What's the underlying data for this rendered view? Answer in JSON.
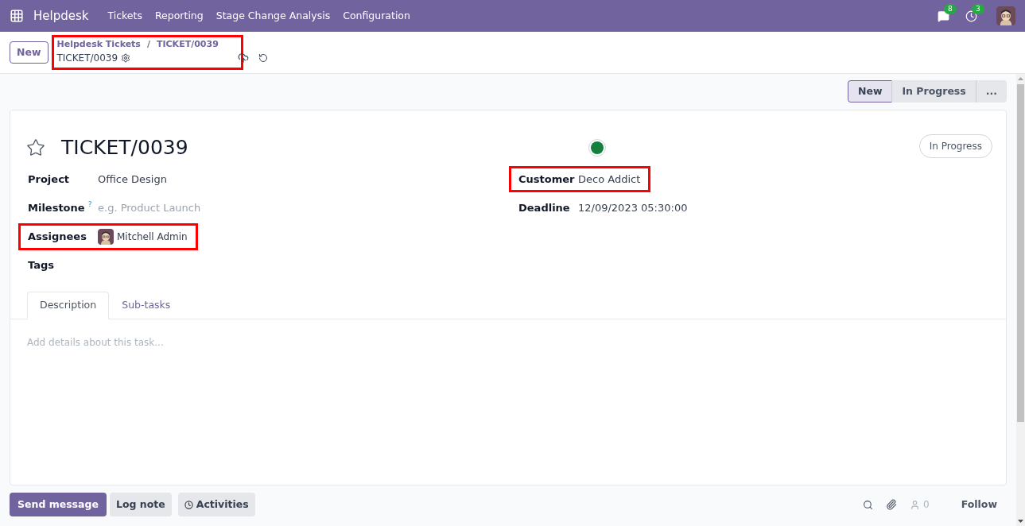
{
  "navbar": {
    "app_name": "Helpdesk",
    "menu": [
      "Tickets",
      "Reporting",
      "Stage Change Analysis",
      "Configuration"
    ],
    "messages_count": "8",
    "activities_count": "3"
  },
  "control_panel": {
    "new_button": "New",
    "breadcrumb": [
      "Helpdesk Tickets",
      "TICKET/0039"
    ],
    "breadcrumb_separator": "/",
    "record_name": "TICKET/0039",
    "highlighted": true
  },
  "stages": [
    {
      "label": "New",
      "selected": true
    },
    {
      "label": "In Progress",
      "selected": false
    },
    {
      "label": "...",
      "selected": false
    }
  ],
  "form": {
    "title": "TICKET/0039",
    "starred": false,
    "status_badge": "In Progress",
    "left_fields": [
      {
        "kind": "text",
        "label": "Project",
        "value": "Office Design",
        "highlighted": false
      },
      {
        "kind": "placeholder",
        "label": "Milestone",
        "help": "?",
        "placeholder": "e.g. Product Launch",
        "highlighted": false
      },
      {
        "kind": "user",
        "label": "Assignees",
        "value": "Mitchell Admin",
        "highlighted": true
      },
      {
        "kind": "empty",
        "label": "Tags",
        "highlighted": false
      }
    ],
    "right_fields": [
      {
        "kind": "text",
        "label": "Customer",
        "value": "Deco Addict",
        "highlighted": true
      },
      {
        "kind": "text",
        "label": "Deadline",
        "value": "12/09/2023 05:30:00",
        "highlighted": false
      }
    ],
    "tabs": [
      {
        "label": "Description",
        "selected": true
      },
      {
        "label": "Sub-tasks",
        "selected": false
      }
    ],
    "description": {
      "placeholder": "Add details about this task..."
    }
  },
  "chatter": {
    "buttons": [
      {
        "label": "Send message",
        "kind": "primary"
      },
      {
        "label": "Log note",
        "kind": "secondary"
      },
      {
        "label": "Activities",
        "kind": "activities"
      }
    ],
    "followers_count": "0",
    "follow": "Follow"
  }
}
